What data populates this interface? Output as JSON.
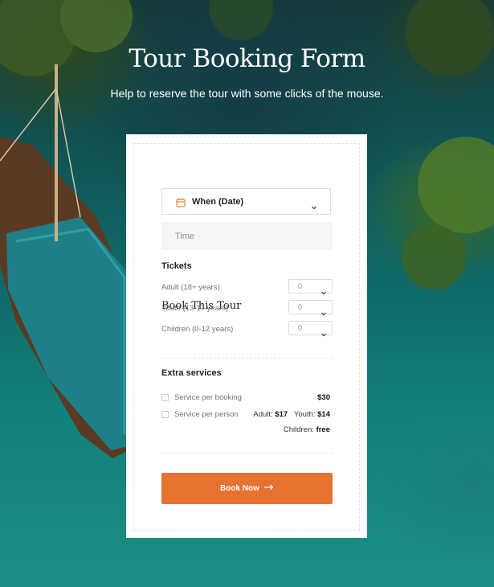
{
  "hero": {
    "title": "Tour Booking Form",
    "subtitle": "Help to reserve the tour with some clicks of the mouse."
  },
  "form": {
    "title": "Book This Tour",
    "date_label": "When (Date)",
    "time_placeholder": "Time",
    "tickets_heading": "Tickets",
    "tickets": [
      {
        "label": "Adult (18+ years)",
        "value": "0"
      },
      {
        "label": "Youth (13-17 years)",
        "value": "0"
      },
      {
        "label": "Children (0-12 years)",
        "value": "0"
      }
    ],
    "extras_heading": "Extra services",
    "services": [
      {
        "label": "Service per booking",
        "price": "$30"
      },
      {
        "label": "Service per person",
        "adult_label": "Adult:",
        "adult_price": "$17",
        "youth_label": "Youth:",
        "youth_price": "$14",
        "children_label": "Children:",
        "children_price": "free"
      }
    ],
    "submit_label": "Book Now"
  },
  "colors": {
    "accent": "#e67230",
    "icon_accent": "#e67230"
  }
}
